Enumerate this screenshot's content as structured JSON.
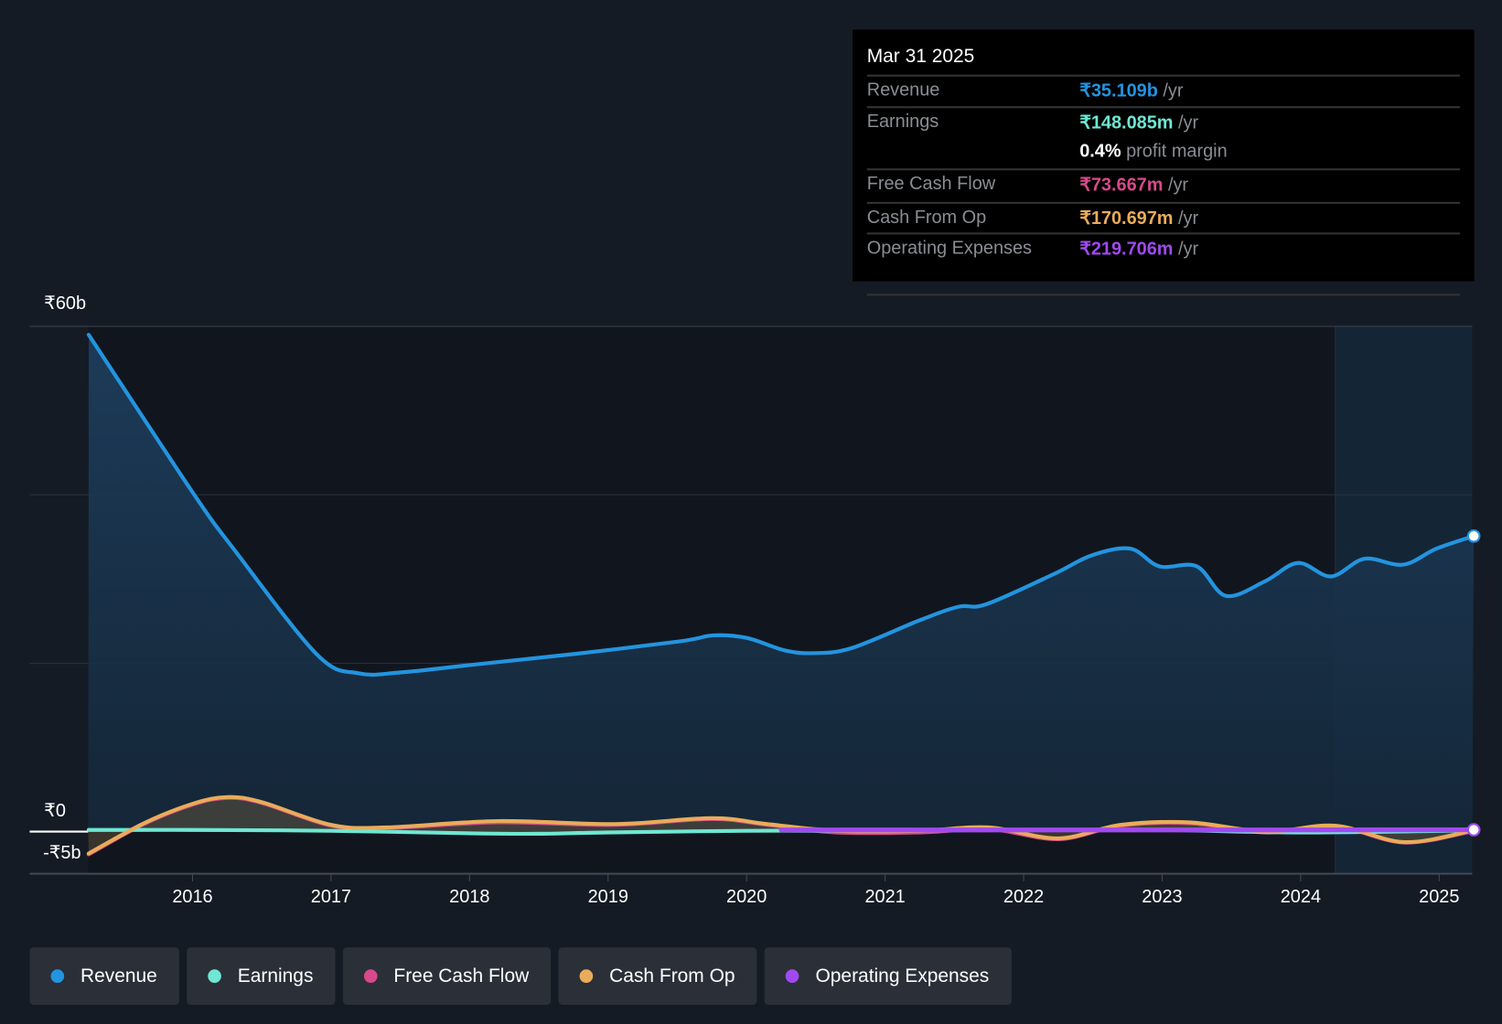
{
  "tooltip": {
    "date": "Mar 31 2025",
    "rows": [
      {
        "label": "Revenue",
        "value": "₹35.109b",
        "unit": " /yr",
        "color": "#2394df"
      },
      {
        "label": "Earnings",
        "value": "₹148.085m",
        "unit": " /yr",
        "color": "#6ee7d3"
      },
      {
        "label": "",
        "value": "0.4%",
        "unit": " profit margin",
        "color": "#ffffff"
      },
      {
        "label": "Free Cash Flow",
        "value": "₹73.667m",
        "unit": " /yr",
        "color": "#d8498a"
      },
      {
        "label": "Cash From Op",
        "value": "₹170.697m",
        "unit": " /yr",
        "color": "#e9ac5a"
      },
      {
        "label": "Operating Expenses",
        "value": "₹219.706m",
        "unit": " /yr",
        "color": "#a149f0"
      }
    ]
  },
  "chart_data": {
    "type": "line",
    "ylim": [
      -5,
      60
    ],
    "xlim": [
      2015.25,
      2025.25
    ],
    "y_tick_labels": {
      "top": "₹60b",
      "zero": "₹0",
      "bottom": "-₹5b"
    },
    "x_tick_labels": [
      "2016",
      "2017",
      "2018",
      "2019",
      "2020",
      "2021",
      "2022",
      "2023",
      "2024",
      "2025"
    ],
    "highlight_range": [
      2024.25,
      2025.25
    ],
    "series": [
      {
        "name": "Revenue",
        "color": "#2394df",
        "x": [
          2015.25,
          2016.0,
          2016.3,
          2016.9,
          2017.2,
          2017.5,
          2018.07,
          2018.76,
          2019.52,
          2019.76,
          2020.0,
          2020.28,
          2020.49,
          2020.76,
          2021.25,
          2021.53,
          2021.73,
          2022.22,
          2022.49,
          2022.77,
          2022.98,
          2023.25,
          2023.46,
          2023.74,
          2023.98,
          2024.22,
          2024.46,
          2024.74,
          2024.98,
          2025.25
        ],
        "y": [
          59,
          40.3,
          33.5,
          21,
          18.8,
          18.9,
          19.9,
          21.1,
          22.6,
          23.3,
          23,
          21.5,
          21.2,
          21.8,
          25.1,
          26.7,
          27,
          30.6,
          32.8,
          33.6,
          31.5,
          31.5,
          28,
          29.7,
          31.9,
          30.3,
          32.4,
          31.7,
          33.6,
          35.1
        ]
      },
      {
        "name": "Earnings",
        "color": "#6ee7d3",
        "x": [
          2015.25,
          2016.0,
          2017.0,
          2018.0,
          2018.5,
          2019.0,
          2020.0,
          2021.0,
          2022.0,
          2023.0,
          2024.0,
          2025.25
        ],
        "y": [
          0.2,
          0.2,
          0.1,
          -0.2,
          -0.25,
          -0.1,
          0.1,
          0.1,
          0.2,
          0.2,
          -0.1,
          0.15
        ]
      },
      {
        "name": "Free Cash Flow",
        "color": "#d8498a",
        "x": [
          2015.25,
          2015.65,
          2016.0,
          2016.25,
          2016.5,
          2017.0,
          2017.4,
          2018.2,
          2019.05,
          2019.75,
          2020.15,
          2020.65,
          2021.25,
          2021.75,
          2022.25,
          2022.7,
          2023.2,
          2023.75,
          2024.25,
          2024.75,
          2025.25
        ],
        "y": [
          -2.7,
          0.9,
          3.2,
          4.0,
          3.4,
          0.7,
          0.4,
          1.1,
          0.8,
          1.5,
          0.8,
          -0.1,
          -0.1,
          0.3,
          -0.9,
          0.7,
          1.0,
          -0.1,
          0.6,
          -1.3,
          0.07
        ]
      },
      {
        "name": "Cash From Op",
        "color": "#e9ac5a",
        "x": [
          2015.25,
          2015.65,
          2016.0,
          2016.25,
          2016.5,
          2017.0,
          2017.4,
          2018.2,
          2019.05,
          2019.75,
          2020.15,
          2020.65,
          2021.25,
          2021.75,
          2022.25,
          2022.7,
          2023.2,
          2023.75,
          2024.25,
          2024.75,
          2025.25
        ],
        "y": [
          -2.6,
          1.0,
          3.3,
          4.1,
          3.5,
          0.8,
          0.5,
          1.25,
          0.9,
          1.6,
          0.9,
          0.1,
          0.1,
          0.5,
          -0.8,
          0.8,
          1.1,
          0,
          0.7,
          -1.25,
          0.17
        ]
      },
      {
        "name": "Operating Expenses",
        "color": "#a149f0",
        "x": [
          2020.25,
          2021.0,
          2022.0,
          2023.0,
          2024.0,
          2025.25
        ],
        "y": [
          0.2,
          0.2,
          0.2,
          0.2,
          0.2,
          0.22
        ]
      }
    ]
  },
  "legend": [
    "Revenue",
    "Earnings",
    "Free Cash Flow",
    "Cash From Op",
    "Operating Expenses"
  ]
}
